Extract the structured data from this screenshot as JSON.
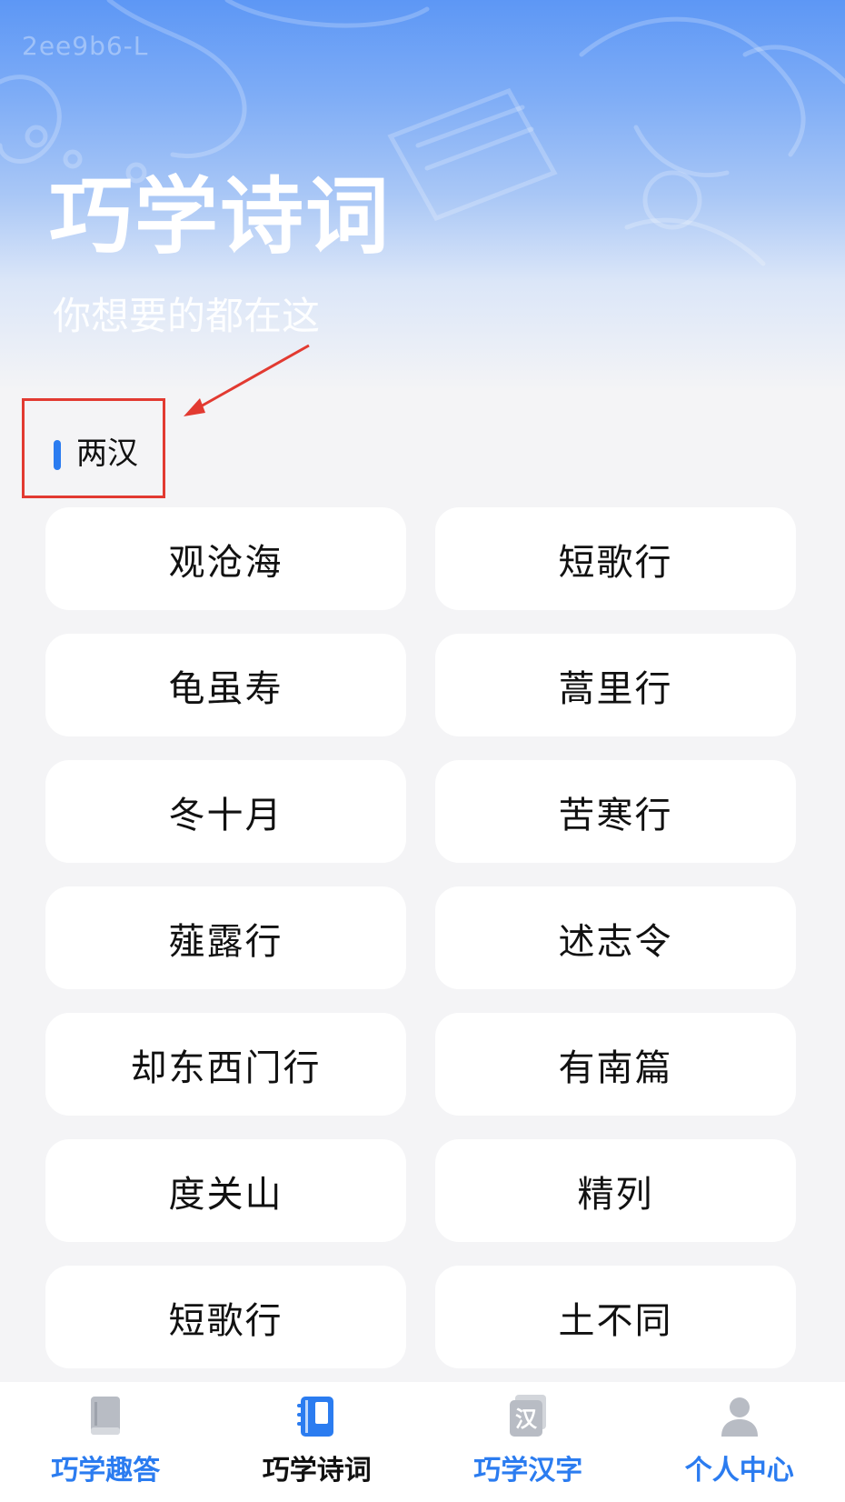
{
  "watermark": "2ee9b6-L",
  "hero": {
    "title": "巧学诗词",
    "subtitle": "你想要的都在这"
  },
  "section": {
    "label": "两汉"
  },
  "poems": [
    "观沧海",
    "短歌行",
    "龟虽寿",
    "蒿里行",
    "冬十月",
    "苦寒行",
    "薤露行",
    "述志令",
    "却东西门行",
    "有南篇",
    "度关山",
    "精列",
    "短歌行",
    "土不同"
  ],
  "tabbar": {
    "items": [
      {
        "label": "巧学趣答",
        "icon": "book-icon",
        "active": false
      },
      {
        "label": "巧学诗词",
        "icon": "notebook-icon",
        "active": true
      },
      {
        "label": "巧学汉字",
        "icon": "han-character-icon",
        "icon_text": "汉",
        "active": false
      },
      {
        "label": "个人中心",
        "icon": "person-icon",
        "active": false
      }
    ]
  },
  "colors": {
    "accent": "#2b7cf0",
    "highlight_box": "#e23a31",
    "icon_inactive": "#b8bcc4"
  }
}
